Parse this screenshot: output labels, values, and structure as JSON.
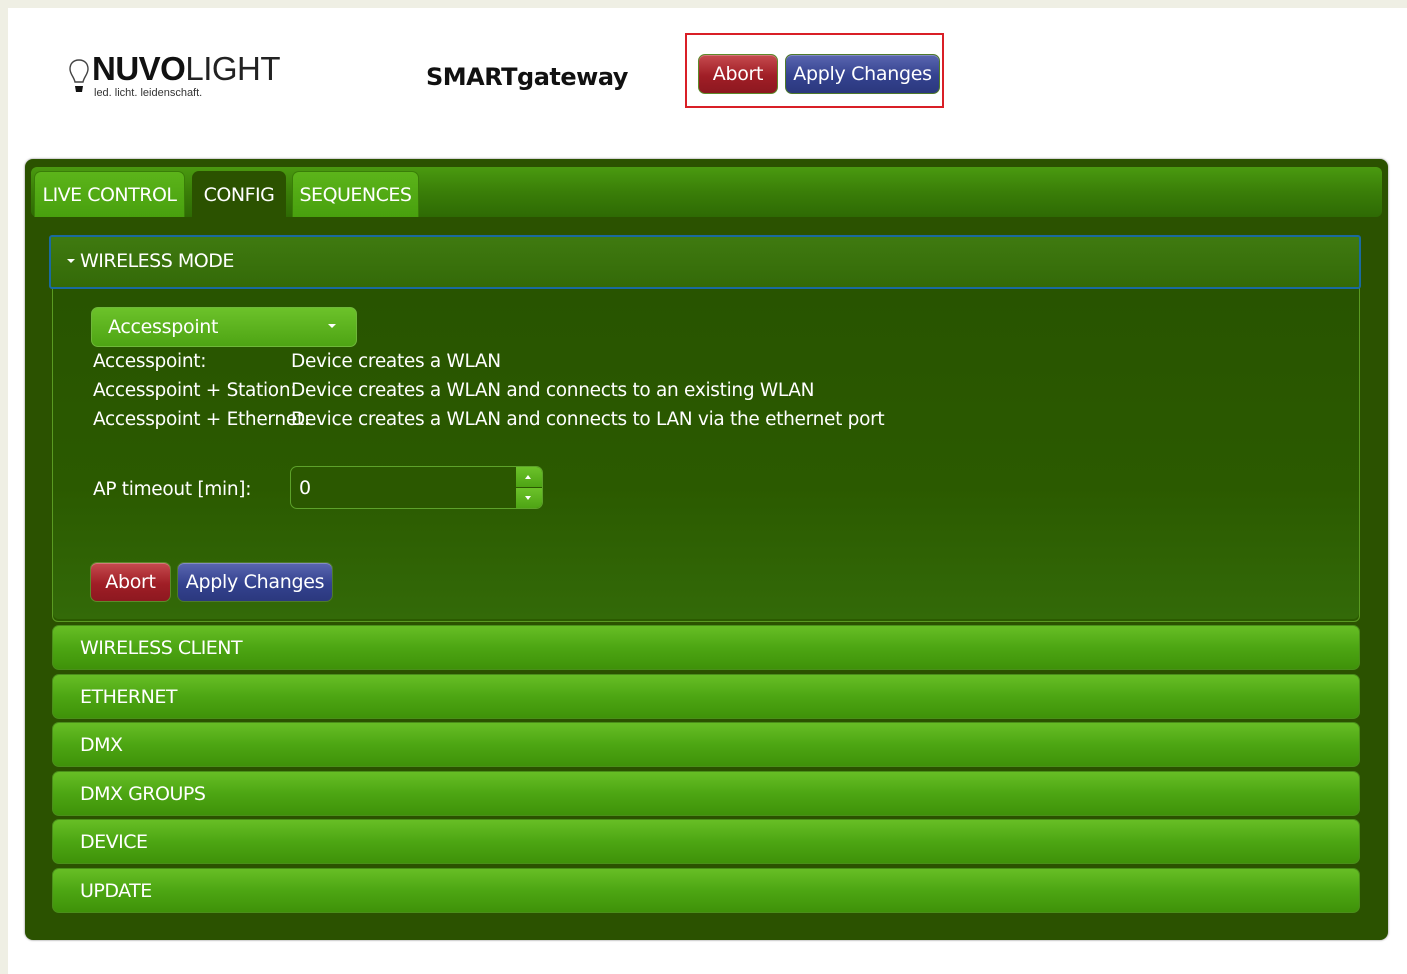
{
  "header": {
    "logo_bold": "NUVO",
    "logo_light": "LIGHT",
    "logo_tagline": "led. licht. leidenschaft.",
    "app_title": "SMARTgateway",
    "abort_label": "Abort",
    "apply_label": "Apply Changes"
  },
  "tabs": [
    {
      "label": "LIVE CONTROL",
      "active": false
    },
    {
      "label": "CONFIG",
      "active": true
    },
    {
      "label": "SEQUENCES",
      "active": false
    }
  ],
  "wireless_mode": {
    "title": "WIRELESS MODE",
    "selected_mode": "Accesspoint",
    "descriptions": [
      {
        "key": "Accesspoint:",
        "value": "Device creates a WLAN"
      },
      {
        "key": "Accesspoint + Station:",
        "value": "Device creates a WLAN and connects to an existing WLAN"
      },
      {
        "key": "Accesspoint + Ethernet:",
        "value": "Device creates a WLAN and connects to LAN via the ethernet port"
      }
    ],
    "ap_timeout_label": "AP timeout [min]:",
    "ap_timeout_value": "0",
    "abort_label": "Abort",
    "apply_label": "Apply Changes"
  },
  "sections": [
    {
      "label": "WIRELESS CLIENT"
    },
    {
      "label": "ETHERNET"
    },
    {
      "label": "DMX"
    },
    {
      "label": "DMX GROUPS"
    },
    {
      "label": "DEVICE"
    },
    {
      "label": "UPDATE"
    }
  ],
  "colors": {
    "panel": "#2b5200",
    "accent_green": "#4ea414",
    "abort_red": "#a01e26",
    "apply_blue": "#34428f",
    "highlight_box": "#d91f26"
  }
}
